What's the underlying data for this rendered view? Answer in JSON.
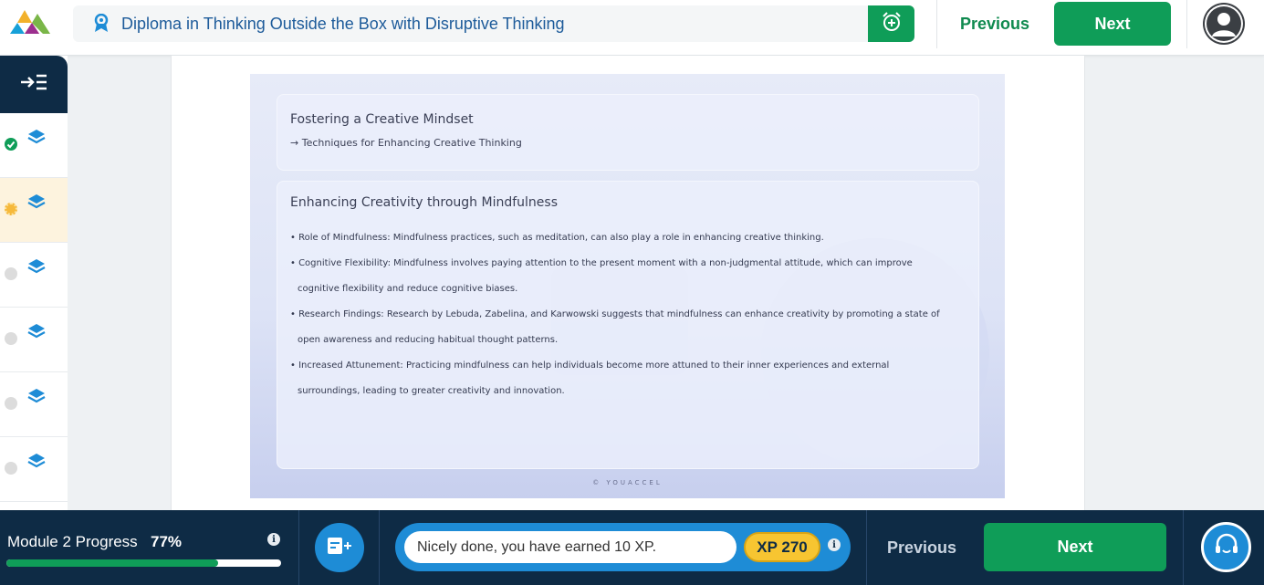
{
  "header": {
    "course_title": "Diploma in Thinking Outside the Box with Disruptive Thinking",
    "prev_label": "Previous",
    "next_label": "Next",
    "icons": [
      "logo-icon",
      "award-badge-icon",
      "alarm-add-icon",
      "user-avatar-icon"
    ]
  },
  "sidebar": {
    "toggle_icon": "collapse-menu-icon",
    "items": [
      {
        "status": "completed",
        "status_color": "#0f9d58",
        "icon": "layers-icon"
      },
      {
        "status": "in-progress",
        "status_color": "#f6b93b",
        "icon": "layers-icon"
      },
      {
        "status": "locked",
        "status_color": "#d9d9d9",
        "icon": "layers-icon"
      },
      {
        "status": "locked",
        "status_color": "#d9d9d9",
        "icon": "layers-icon"
      },
      {
        "status": "locked",
        "status_color": "#d9d9d9",
        "icon": "layers-icon"
      },
      {
        "status": "locked",
        "status_color": "#d9d9d9",
        "icon": "layers-icon"
      }
    ]
  },
  "slide": {
    "panel1": {
      "title": "Fostering a Creative Mindset",
      "subitem": "→ Techniques for Enhancing Creative Thinking"
    },
    "panel2": {
      "title": "Enhancing Creativity through Mindfulness",
      "bullets": [
        {
          "line1": "• Role of Mindfulness: Mindfulness practices, such as meditation, can also play a role in enhancing creative thinking.",
          "line2": ""
        },
        {
          "line1": "• Cognitive Flexibility: Mindfulness involves paying attention to the present moment with a non-judgmental attitude, which can improve",
          "line2": "cognitive flexibility and reduce cognitive biases."
        },
        {
          "line1": "• Research Findings: Research by Lebuda, Zabelina, and Karwowski suggests that mindfulness can enhance creativity by promoting a state of",
          "line2": "open awareness and reducing habitual thought patterns."
        },
        {
          "line1": "• Increased Attunement: Practicing mindfulness can help individuals become more attuned to their inner experiences and external",
          "line2": "surroundings, leading to greater creativity and innovation."
        }
      ]
    },
    "watermark": "© YOUACCEL"
  },
  "footer": {
    "progress_label": "Module 2 Progress",
    "progress_percent": "77%",
    "progress_value": 0.77,
    "xp_message": "Nicely done, you have earned 10 XP.",
    "xp_badge": "XP 270",
    "prev_label": "Previous",
    "next_label": "Next",
    "icons": [
      "info-icon",
      "add-note-icon",
      "support-headset-icon"
    ]
  },
  "colors": {
    "accent_green": "#0f9d58",
    "navy": "#0e2b45",
    "blue": "#1e8cd6",
    "xp_gold": "#f7c531"
  }
}
